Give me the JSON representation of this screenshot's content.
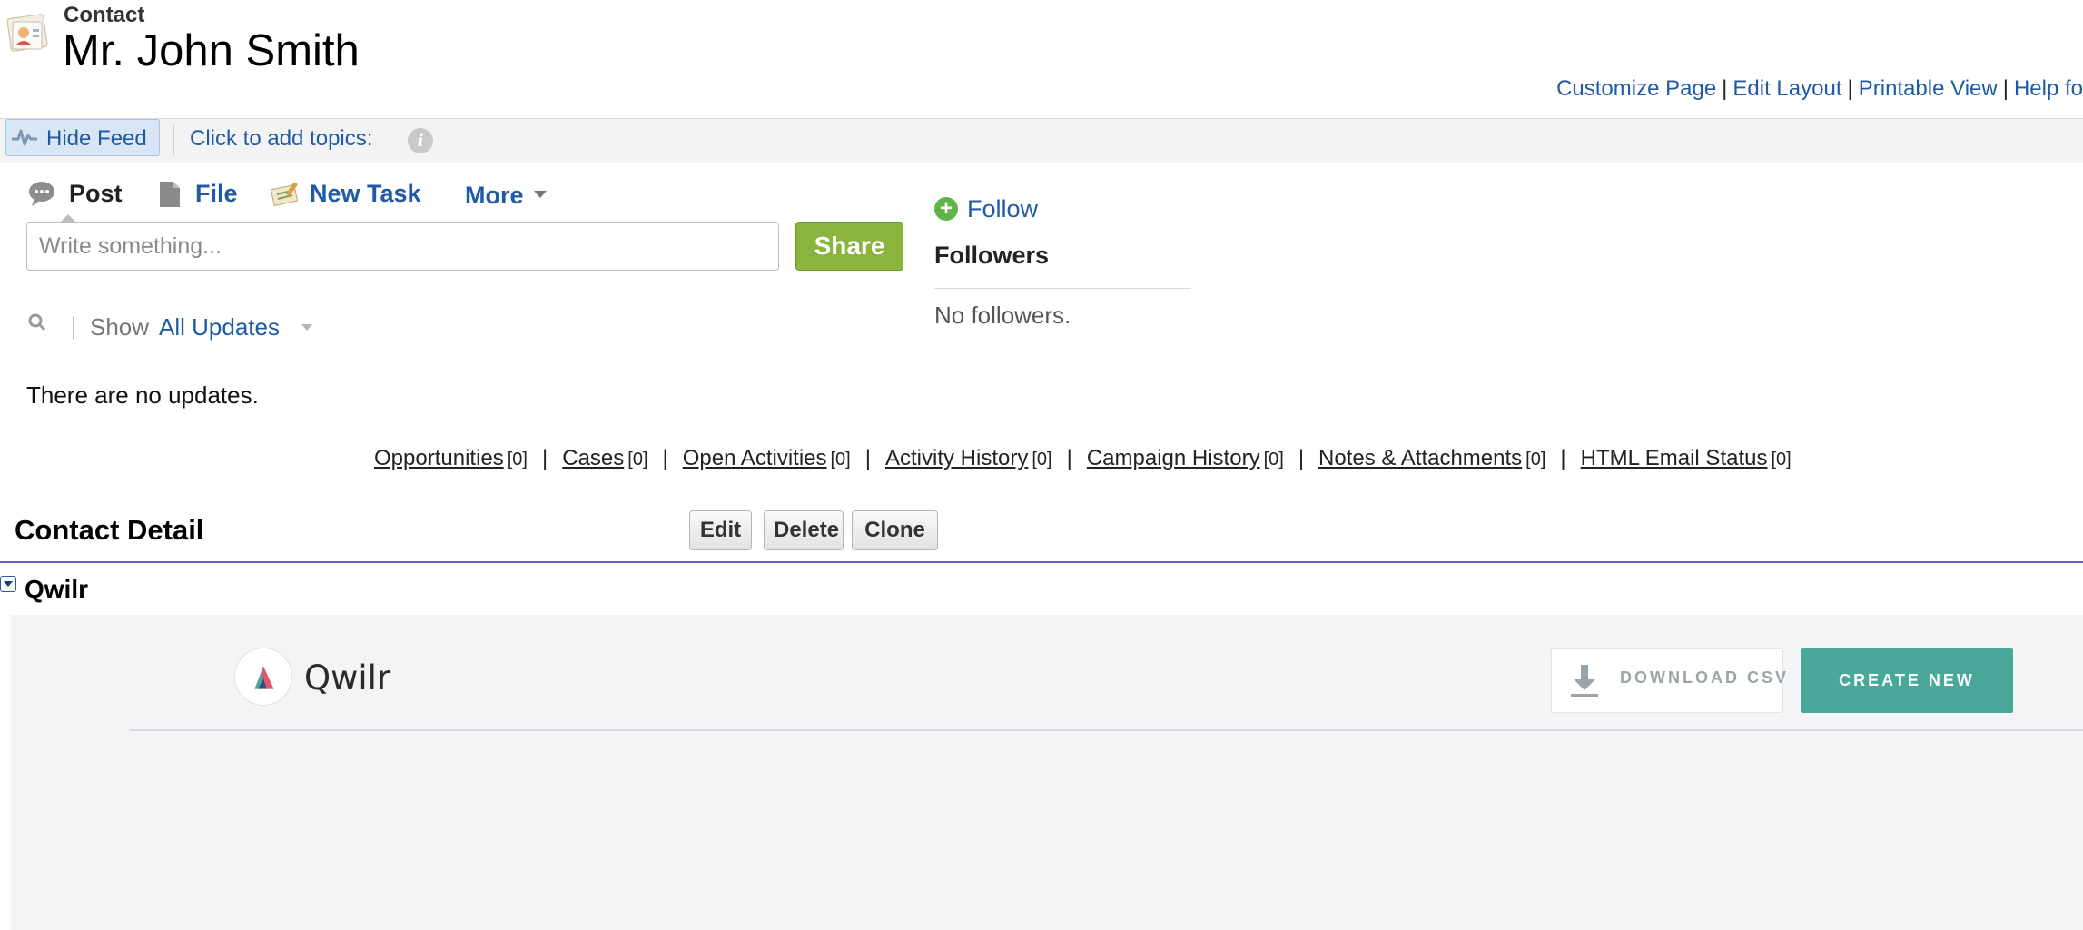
{
  "header": {
    "record_type": "Contact",
    "record_name": "Mr. John Smith"
  },
  "top_links": [
    {
      "label": "Customize Page"
    },
    {
      "label": "Edit Layout"
    },
    {
      "label": "Printable View"
    },
    {
      "label": "Help fo"
    }
  ],
  "top_links_separator": "|",
  "feed_bar": {
    "hide_feed_label": "Hide Feed",
    "topics_label": "Click to add topics:",
    "info_glyph": "i"
  },
  "publisher": {
    "tabs": {
      "post": "Post",
      "file": "File",
      "new_task": "New Task",
      "more": "More"
    },
    "input_placeholder": "Write something...",
    "share_label": "Share",
    "filter": {
      "show_label": "Show",
      "selected": "All Updates"
    },
    "empty_message": "There are no updates."
  },
  "follow": {
    "follow_label": "Follow",
    "followers_title": "Followers",
    "no_followers": "No followers."
  },
  "related_lists": [
    {
      "label": "Opportunities",
      "count": "[0]"
    },
    {
      "label": "Cases",
      "count": "[0]"
    },
    {
      "label": "Open Activities",
      "count": "[0]"
    },
    {
      "label": "Activity History",
      "count": "[0]"
    },
    {
      "label": "Campaign History",
      "count": "[0]"
    },
    {
      "label": "Notes & Attachments",
      "count": "[0]"
    },
    {
      "label": "HTML Email Status",
      "count": "[0]"
    }
  ],
  "related_separator": "|",
  "detail": {
    "title": "Contact Detail",
    "buttons": {
      "edit": "Edit",
      "delete": "Delete",
      "clone": "Clone"
    }
  },
  "qwilr": {
    "section_title": "Qwilr",
    "logo_text": "Qwilr",
    "download_label": "DOWNLOAD CSV",
    "create_label": "CREATE NEW"
  },
  "colors": {
    "link": "#1f5aa5",
    "share_button": "#8ab43d",
    "detail_rule": "#6a5fc7",
    "create_button": "#4aa89a",
    "panel_bg": "#f3f4f6"
  },
  "icons": [
    "contact-card-icon",
    "pulse-icon",
    "info-icon",
    "chat-bubble-icon",
    "document-icon",
    "task-icon",
    "caret-down-icon",
    "search-icon",
    "plus-circle-icon",
    "collapse-icon",
    "qwilr-logo-icon",
    "download-icon"
  ]
}
